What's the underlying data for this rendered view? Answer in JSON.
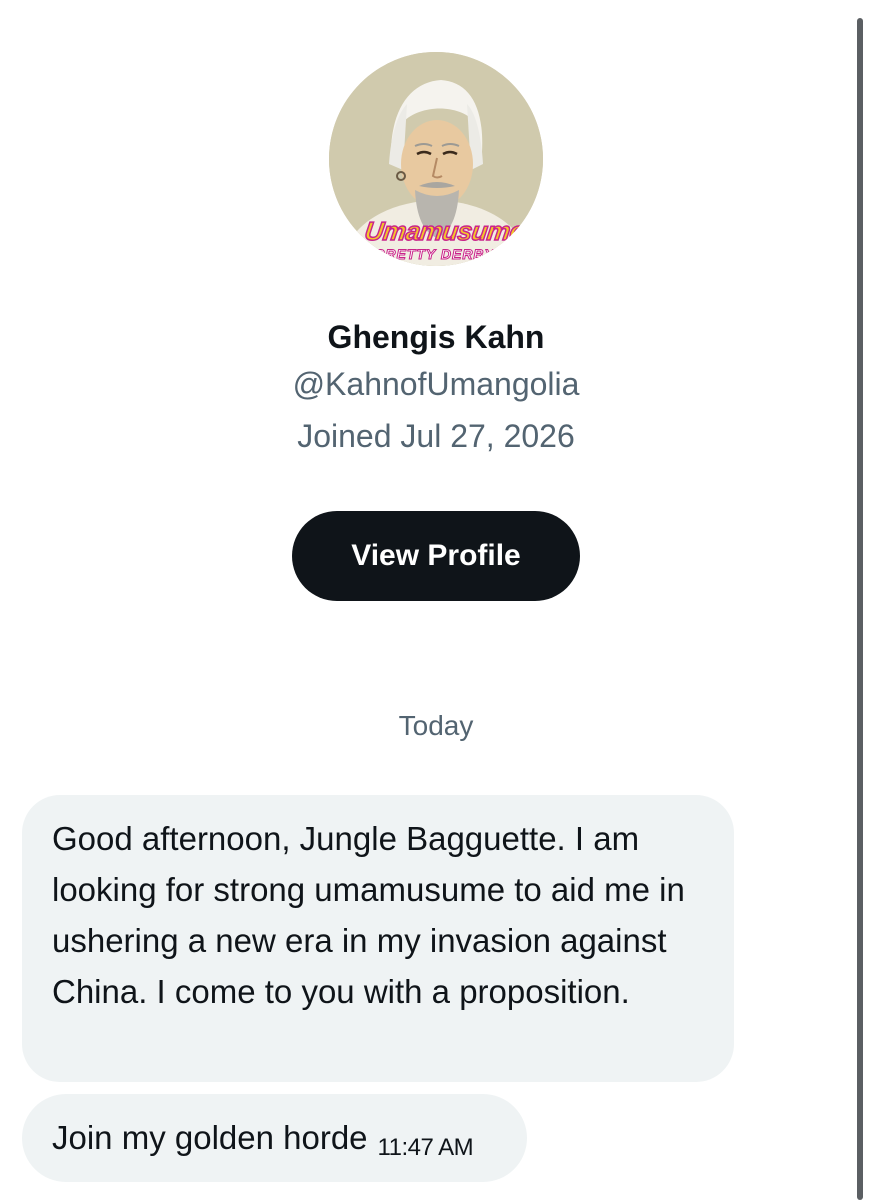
{
  "profile": {
    "display_name": "Ghengis Kahn",
    "handle": "@KahnofUmangolia",
    "joined": "Joined Jul 27, 2026",
    "avatar_brand": "Umamusume",
    "avatar_subtitle": "PRETTY DERBY",
    "view_profile_label": "View Profile"
  },
  "conversation": {
    "date_separator": "Today",
    "messages": [
      {
        "text": "Good afternoon, Jungle Bagguette. I am looking for strong umamusume to aid me in ushering a new era in my invasion against China. I come to you with a proposition."
      },
      {
        "text": "Join my golden horde",
        "time": "11:47 AM"
      }
    ]
  },
  "colors": {
    "primary_text": "#0f1419",
    "secondary_text": "#536471",
    "bubble_bg": "#eff3f4",
    "button_bg": "#0f1419"
  }
}
